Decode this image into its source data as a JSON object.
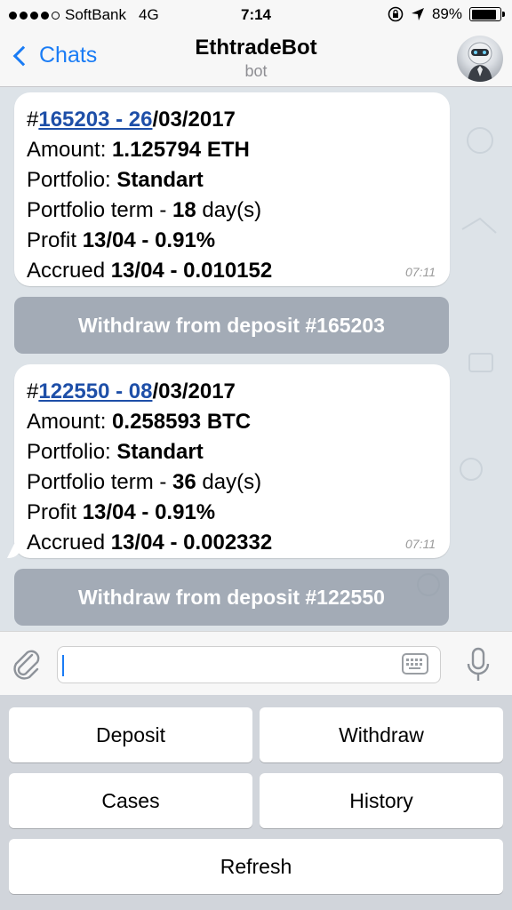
{
  "status_bar": {
    "carrier": "SoftBank",
    "network": "4G",
    "time": "7:14",
    "battery": "89%",
    "battery_level": 0.89
  },
  "nav": {
    "back_label": "Chats",
    "title": "EthtradeBot",
    "subtitle": "bot"
  },
  "messages": [
    {
      "hash": "#",
      "link_text": "165203 - 26",
      "date_rest": "/03/2017",
      "amount_label": "Amount: ",
      "amount_value": "1.125794 ETH",
      "portfolio_label": "Portfolio: ",
      "portfolio_value": "Standart",
      "term_label": "Portfolio term - ",
      "term_value": "18",
      "term_unit": " day(s)",
      "profit_label": "Profit ",
      "profit_value": "13/04 - 0.91%",
      "accrued_label": "Accrued ",
      "accrued_value": "13/04 - 0.010152",
      "time": "07:11",
      "button": "Withdraw from deposit #165203"
    },
    {
      "hash": "#",
      "link_text": "122550 - 08",
      "date_rest": "/03/2017",
      "amount_label": "Amount: ",
      "amount_value": "0.258593 BTC",
      "portfolio_label": "Portfolio: ",
      "portfolio_value": "Standart",
      "term_label": "Portfolio term - ",
      "term_value": "36",
      "term_unit": " day(s)",
      "profit_label": "Profit ",
      "profit_value": "13/04 - 0.91%",
      "accrued_label": "Accrued ",
      "accrued_value": "13/04 - 0.002332",
      "time": "07:11",
      "button": "Withdraw from deposit #122550"
    }
  ],
  "input": {
    "placeholder": ""
  },
  "keyboard": {
    "deposit": "Deposit",
    "withdraw": "Withdraw",
    "cases": "Cases",
    "history": "History",
    "refresh": "Refresh"
  },
  "colors": {
    "accent": "#1a7cf5",
    "link": "#1e4fa8",
    "chat_bg": "#dde3e8",
    "inline_button": "#8c96a2"
  },
  "icons": [
    "signal-dots-icon",
    "lock-rotation-icon",
    "location-arrow-icon",
    "battery-icon",
    "back-chevron-icon",
    "bot-avatar",
    "paperclip-icon",
    "keyboard-icon",
    "microphone-icon"
  ]
}
